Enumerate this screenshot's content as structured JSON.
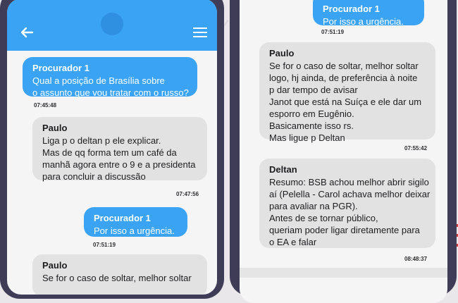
{
  "left_phone": {
    "header": {
      "back_icon": "arrow-left-icon",
      "menu_icon": "hamburger-menu-icon",
      "color": "#3aa3f3"
    },
    "messages": [
      {
        "direction": "outgoing",
        "sender": "Procurador 1",
        "lines": [
          "Qual a posição de Brasília sobre",
          "o assunto que vou tratar com o russo?"
        ],
        "time": "07:45:48"
      },
      {
        "direction": "incoming",
        "sender": "Paulo",
        "lines": [
          "Liga p o deltan p ele explicar.",
          "Mas de qq forma tem um café da",
          "manhã agora entre o 9 e a presidenta",
          "para concluir a discussão"
        ],
        "time": "07:47:56"
      },
      {
        "direction": "outgoing",
        "sender": "Procurador 1",
        "lines": [
          "Por isso a urgência."
        ],
        "time": "07:51:19"
      },
      {
        "direction": "incoming",
        "sender": "Paulo",
        "lines": [
          "Se for o caso de soltar, melhor soltar"
        ]
      }
    ]
  },
  "right_phone": {
    "messages": [
      {
        "direction": "outgoing",
        "sender": "Procurador 1",
        "lines": [
          "Por isso a urgência."
        ],
        "time": "07:51:19"
      },
      {
        "direction": "incoming",
        "sender": "Paulo",
        "lines": [
          "Se for o caso de soltar, melhor soltar",
          "logo, hj ainda, de preferência à noite",
          "p dar tempo de avisar",
          "Janot que está na Suíça e ele dar um",
          "esporro em Eugênio.",
          "Basicamente isso rs.",
          "Mas ligue p Deltan"
        ],
        "time": "07:55:42"
      },
      {
        "direction": "incoming",
        "sender": "Deltan",
        "lines": [
          "Resumo: BSB achou melhor abrir sigilo",
          "aí (Pelella - Carol achava melhor deixar",
          "para avaliar na PGR).",
          "Antes de se tornar público,",
          "queriam poder ligar diretamente para",
          "o EA e falar"
        ],
        "time": "08:48:37"
      }
    ]
  },
  "colors": {
    "outgoing_bubble": "#3aa3f3",
    "incoming_bubble": "#e3e2e3",
    "phone_frame": "#3f3c57"
  }
}
